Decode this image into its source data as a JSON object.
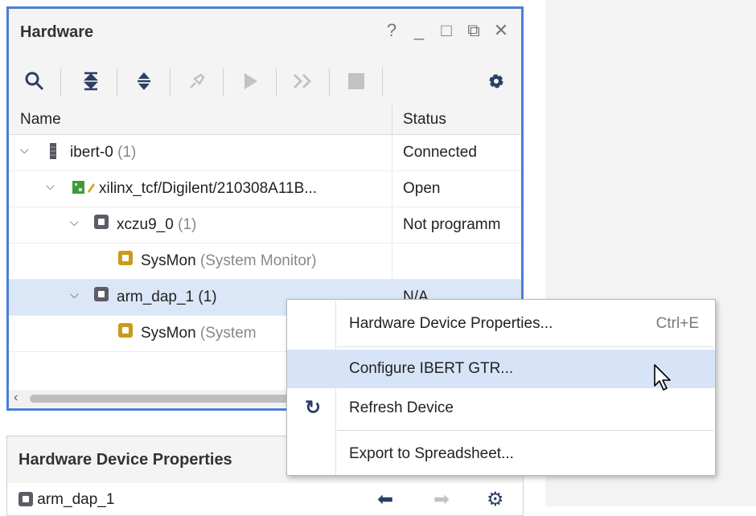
{
  "hardware_panel": {
    "title": "Hardware",
    "window_controls": [
      "?",
      "_",
      "□",
      "⧉",
      "✕"
    ],
    "toolbar": [
      "search-icon",
      "collapse-all-icon",
      "expand-all-icon",
      "auto-connect-icon",
      "run-icon",
      "run-all-icon",
      "stop-icon",
      "gear-icon"
    ],
    "columns": {
      "name": "Name",
      "status": "Status"
    },
    "rows": [
      {
        "name": "ibert-0",
        "count": "(1)",
        "status": "Connected"
      },
      {
        "name": "xilinx_tcf/Digilent/210308A11B...",
        "count": "",
        "status": "Open"
      },
      {
        "name": "xczu9_0",
        "count": "(1)",
        "status": "Not programm"
      },
      {
        "name": "SysMon",
        "count": "(System Monitor)",
        "status": ""
      },
      {
        "name": "arm_dap_1 (1)",
        "count": "",
        "status": "N/A"
      },
      {
        "name": "SysMon",
        "count": "(System",
        "status": ""
      }
    ]
  },
  "properties_panel": {
    "title": "Hardware Device Properties",
    "item": "arm_dap_1"
  },
  "context_menu": {
    "items": [
      {
        "label": "Hardware Device Properties...",
        "shortcut": "Ctrl+E"
      },
      {
        "label": "Configure IBERT GTR...",
        "shortcut": ""
      },
      {
        "label": "Refresh Device",
        "shortcut": ""
      },
      {
        "label": "Export to Spreadsheet...",
        "shortcut": ""
      }
    ]
  },
  "colors": {
    "accent": "#4a7fd4",
    "selection": "#dbe6f7",
    "menu_highlight": "#d7e4f7"
  }
}
